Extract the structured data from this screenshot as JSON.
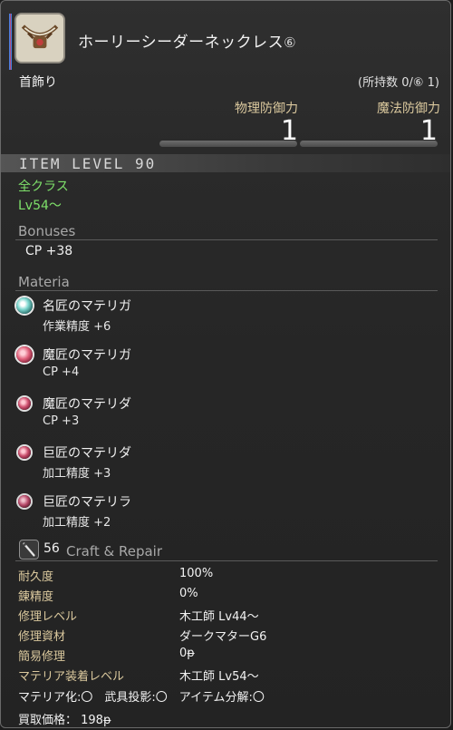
{
  "item": {
    "name": "ホーリーシーダーネックレス",
    "name_symbol": "⑥",
    "slot": "首飾り",
    "owned": "(所持数 0/⑥ 1)"
  },
  "stats": {
    "physical_defense_label": "物理防御力",
    "physical_defense_value": "1",
    "magic_defense_label": "魔法防御力",
    "magic_defense_value": "1"
  },
  "item_level": "ITEM LEVEL 90",
  "class": "全クラス",
  "level_req": "Lv54〜",
  "bonuses": {
    "title": "Bonuses",
    "items": [
      "CP +38"
    ]
  },
  "materia": {
    "title": "Materia",
    "items": [
      {
        "name": "名匠のマテリガ",
        "stat": "作業精度 +6",
        "color": "#7fd8d0"
      },
      {
        "name": "魔匠のマテリガ",
        "stat": "CP +4",
        "color": "#e0607a"
      },
      {
        "name": "魔匠のマテリダ",
        "stat": "CP +3",
        "color": "#d05070"
      },
      {
        "name": "巨匠のマテリダ",
        "stat": "加工精度 +3",
        "color": "#c84c6a"
      },
      {
        "name": "巨匠のマテリラ",
        "stat": "加工精度 +2",
        "color": "#b84a6a"
      }
    ]
  },
  "craft_repair": {
    "level": "56",
    "title": "Craft & Repair",
    "rows": [
      {
        "label": "耐久度",
        "value": "100%"
      },
      {
        "label": "錬精度",
        "value": "0%"
      },
      {
        "label": "修理レベル",
        "value": "木工師 Lv44〜"
      },
      {
        "label": "修理資材",
        "value": "ダークマターG6"
      },
      {
        "label": "簡易修理",
        "value": "0ᵽ"
      },
      {
        "label": "マテリア装着レベル",
        "value": "木工師 Lv54〜"
      }
    ]
  },
  "flags": "マテリア化:〇　武具投影:〇　アイテム分解:〇",
  "sell_price": "買取価格： 198ᵽ",
  "colors": {
    "label_gold": "#dbc99e",
    "green": "#7ee06a",
    "section_gray": "#a8a8a8"
  }
}
